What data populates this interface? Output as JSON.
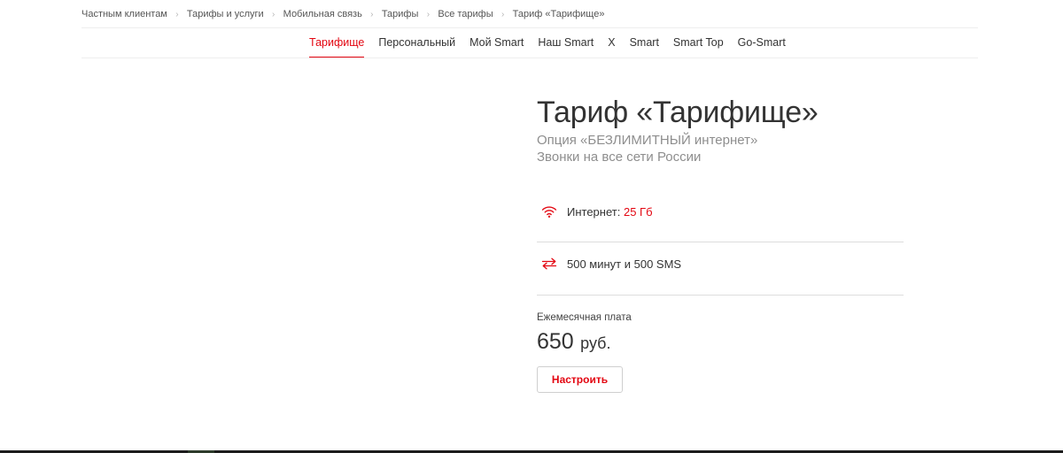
{
  "breadcrumbs": [
    {
      "label": "Частным клиентам"
    },
    {
      "label": "Тарифы и услуги"
    },
    {
      "label": "Мобильная связь"
    },
    {
      "label": "Тарифы"
    },
    {
      "label": "Все тарифы"
    },
    {
      "label": "Тариф «Тарифище»"
    }
  ],
  "breadcrumb_separator": "›",
  "tabs": [
    {
      "label": "Тарифище",
      "active": true
    },
    {
      "label": "Персональный",
      "active": false
    },
    {
      "label": "Мой Smart",
      "active": false
    },
    {
      "label": "Наш Smart",
      "active": false
    },
    {
      "label": "X",
      "active": false
    },
    {
      "label": "Smart",
      "active": false
    },
    {
      "label": "Smart Top",
      "active": false
    },
    {
      "label": "Go-Smart",
      "active": false
    }
  ],
  "tariff": {
    "title": "Тариф «Тарифище»",
    "subtitle_line1": "Опция «БЕЗЛИМИТНЫЙ интернет»",
    "subtitle_line2": "Звонки на все сети России",
    "features": [
      {
        "icon": "wifi-icon",
        "label": "Интернет:",
        "value": "25 Гб"
      },
      {
        "icon": "exchange-arrows-icon",
        "label": "500 минут и 500 SMS",
        "value": ""
      }
    ],
    "fee_label": "Ежемесячная плата",
    "price_amount": "650",
    "price_currency": "руб.",
    "configure_label": "Настроить"
  },
  "colors": {
    "accent": "#e30611",
    "text": "#333333",
    "muted": "#8e8e8e",
    "divider": "#dddddd"
  }
}
